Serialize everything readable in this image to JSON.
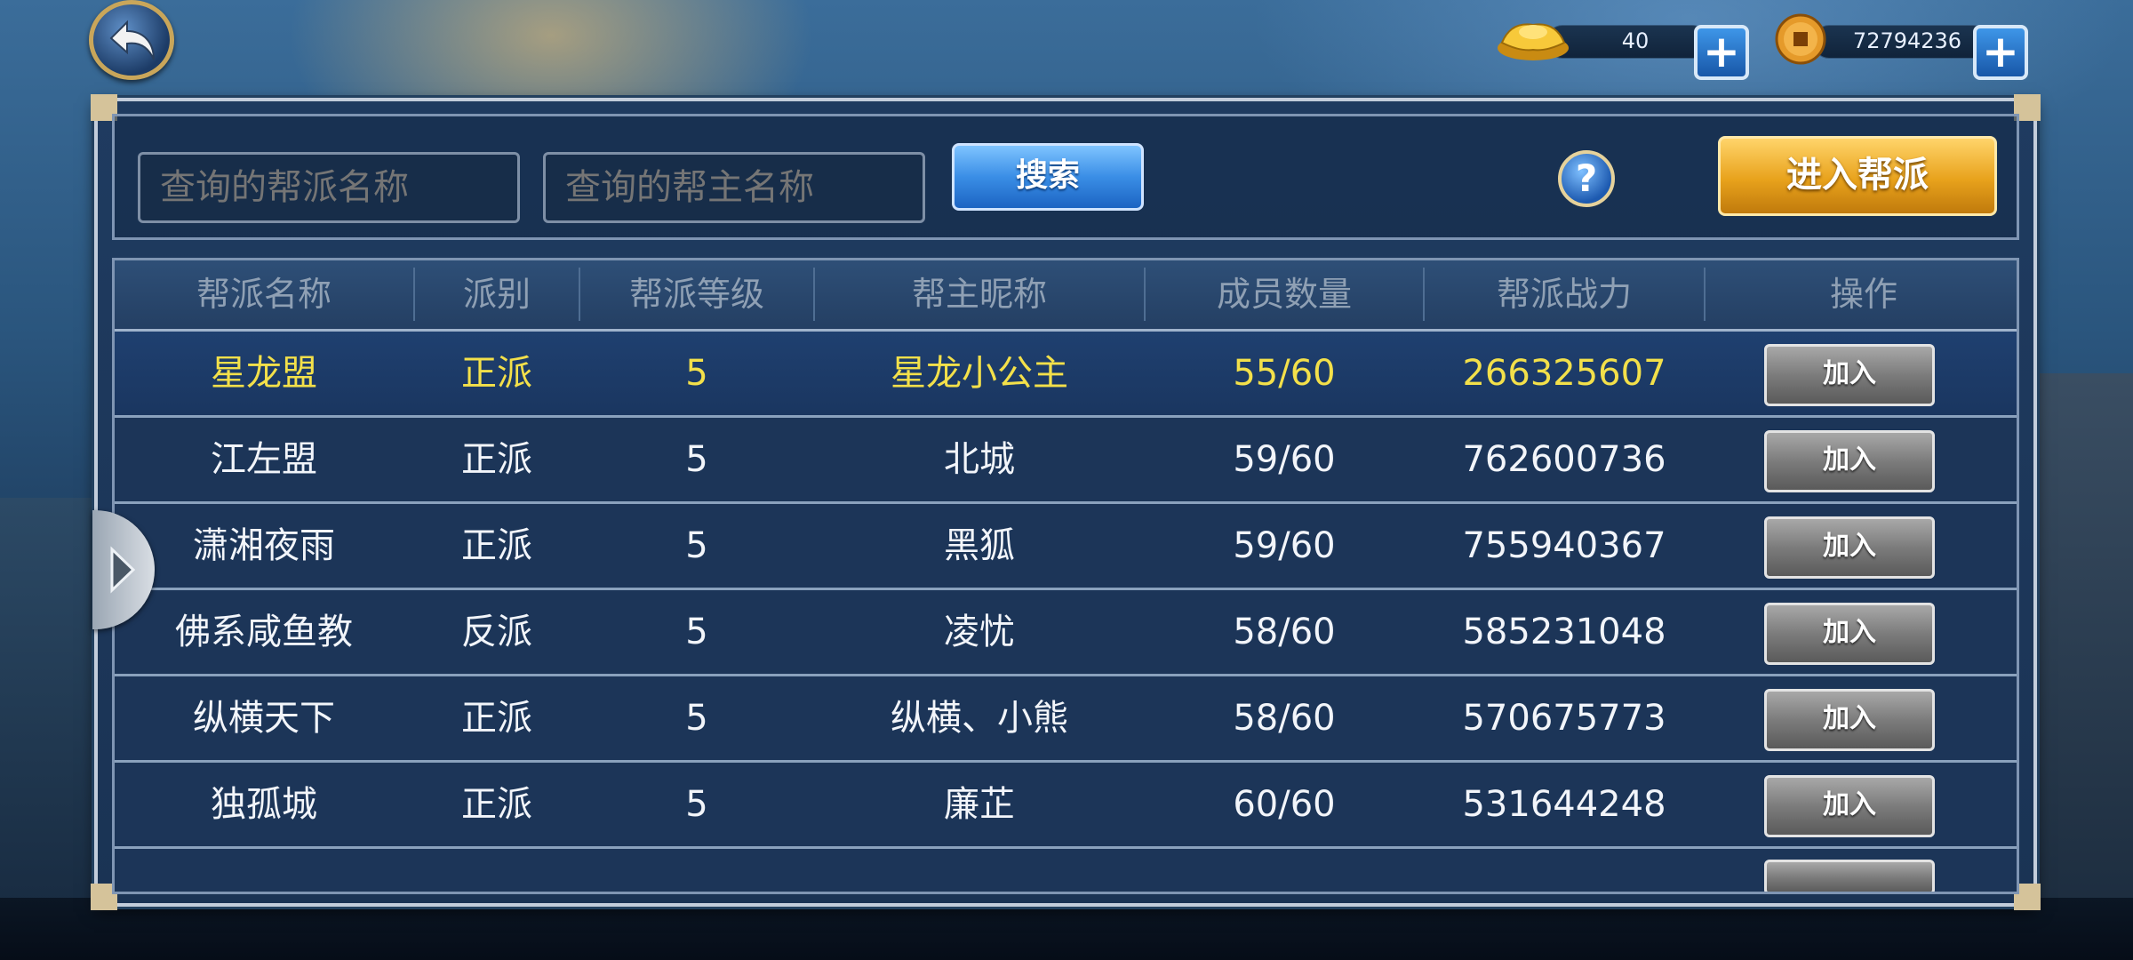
{
  "header": {
    "gold_value": "40",
    "coin_value": "72794236"
  },
  "search": {
    "guild_placeholder": "查询的帮派名称",
    "leader_placeholder": "查询的帮主名称",
    "search_label": "搜索",
    "help_label": "?",
    "enter_label": "进入帮派"
  },
  "table": {
    "headers": [
      "帮派名称",
      "派别",
      "帮派等级",
      "帮主昵称",
      "成员数量",
      "帮派战力",
      "操作"
    ],
    "rows": [
      {
        "name": "星龙盟",
        "faction": "正派",
        "level": "5",
        "leader": "星龙小公主",
        "members": "55/60",
        "power": "266325607",
        "action": "加入"
      },
      {
        "name": "江左盟",
        "faction": "正派",
        "level": "5",
        "leader": "北城",
        "members": "59/60",
        "power": "762600736",
        "action": "加入"
      },
      {
        "name": "潇湘夜雨",
        "faction": "正派",
        "level": "5",
        "leader": "黑狐",
        "members": "59/60",
        "power": "755940367",
        "action": "加入"
      },
      {
        "name": "佛系咸鱼教",
        "faction": "反派",
        "level": "5",
        "leader": "凌忧",
        "members": "58/60",
        "power": "585231048",
        "action": "加入"
      },
      {
        "name": "纵横天下",
        "faction": "正派",
        "level": "5",
        "leader": "纵横、小熊",
        "members": "58/60",
        "power": "570675773",
        "action": "加入"
      },
      {
        "name": "独孤城",
        "faction": "正派",
        "level": "5",
        "leader": "廉芷",
        "members": "60/60",
        "power": "531644248",
        "action": "加入"
      }
    ]
  },
  "colors": {
    "highlight_text": "#f3e04a",
    "normal_text": "#f2f5fa",
    "header_text": "#8fa0b4"
  }
}
